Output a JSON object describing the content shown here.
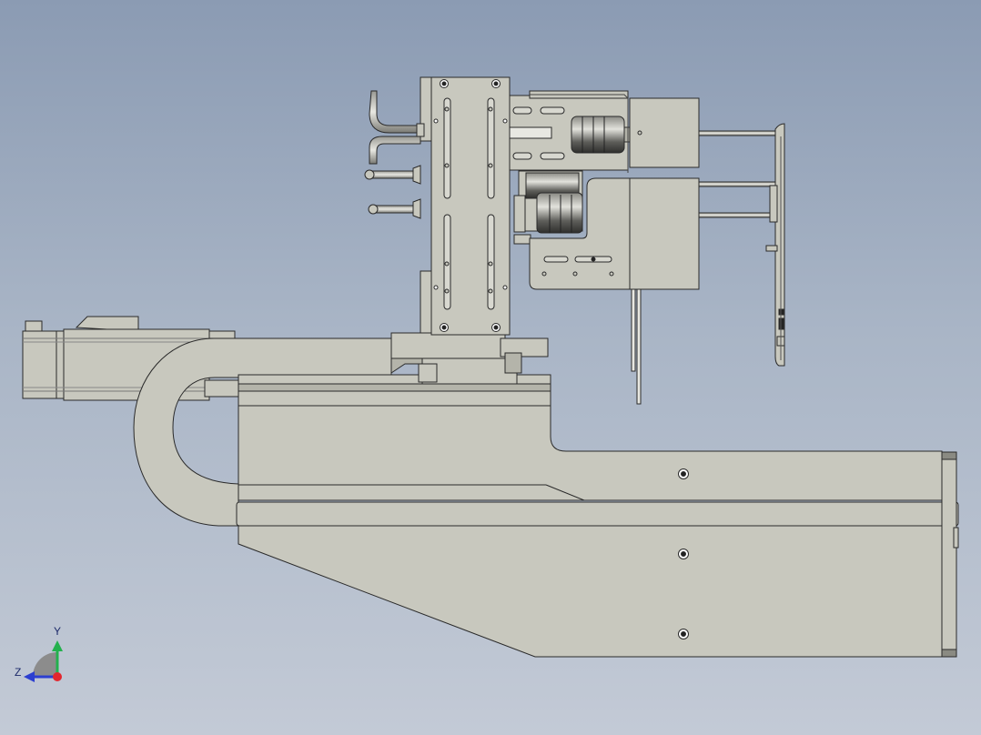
{
  "viewport": {
    "background_top": "#8b9bb3",
    "background_bottom": "#c3cad6",
    "part_fill": "#c8c8be",
    "part_fill_dark": "#b4b4aa",
    "edge_color": "#2a2a2a",
    "shade_color": "#4a4a4a"
  },
  "triad": {
    "y_label": "Y",
    "z_label": "Z",
    "y_color": "#23b14d",
    "z_color": "#2c3fd0",
    "x_color": "#e3262e"
  }
}
